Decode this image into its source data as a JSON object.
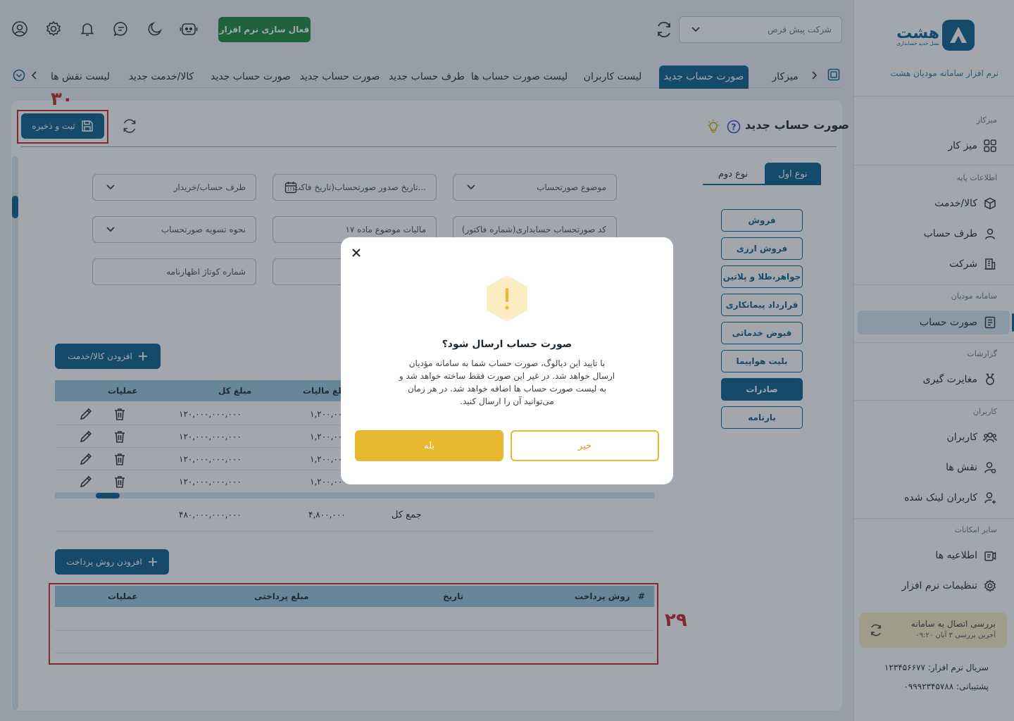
{
  "colors": {
    "primary": "#0f5f8e",
    "success": "#1f8a3d",
    "warning": "#e8b82e",
    "annotation": "#c62828"
  },
  "sidebar": {
    "logo_title": "هشت",
    "logo_tagline": "نسل جدید حسابداری",
    "subtitle": "نرم افزار سامانه مودیان هشت",
    "sections": [
      {
        "title": "میزکار",
        "items": [
          {
            "label": "میز کار",
            "icon": "grid-icon"
          }
        ]
      },
      {
        "title": "اطلاعات پایه",
        "items": [
          {
            "label": "کالا/خدمت",
            "icon": "box-icon"
          },
          {
            "label": "طرف حساب",
            "icon": "user-icon"
          },
          {
            "label": "شرکت",
            "icon": "building-icon"
          }
        ]
      },
      {
        "title": "سامانه مودیان",
        "items": [
          {
            "label": "صورت حساب",
            "icon": "invoice-icon"
          }
        ]
      },
      {
        "title": "گزارشات",
        "items": [
          {
            "label": "مغایرت گیری",
            "icon": "medal-icon"
          }
        ]
      },
      {
        "title": "کاربران",
        "items": [
          {
            "label": "کاربران",
            "icon": "users-icon"
          },
          {
            "label": "نقش ها",
            "icon": "user-role-icon"
          },
          {
            "label": "کاربران لینک شده",
            "icon": "user-link-icon"
          }
        ]
      },
      {
        "title": "سایر امکانات",
        "items": [
          {
            "label": "اطلاعیه ها",
            "icon": "announcement-icon"
          },
          {
            "label": "تنظیمات نرم افزار",
            "icon": "gear-icon"
          }
        ]
      }
    ],
    "connection": {
      "title": "بررسی اتصال به سامانه",
      "last_check": "آخرین بررسی  ۳ آبان  ۰۹:۲۰"
    },
    "serial": "سریال نرم افزار: ۱۲۳۴۵۶۶۷۷",
    "support": "پشتیبانی: ۰۹۹۹۲۳۴۵۷۸۸"
  },
  "header": {
    "company_select": "شرکت پیش فرض",
    "activate_label": "فعال سازی نرم افزار"
  },
  "tabs": [
    "میزکار",
    "صورت حساب جدید",
    "لیست کاربران",
    "لیست صورت حساب ها",
    "طرف حساب جدید",
    "صورت حساب جدید",
    "صورت حساب جدید",
    "کالا/خدمت جدید",
    "لیست نقش ها"
  ],
  "page": {
    "title": "صورت حساب جدید",
    "save_label": "ثبت و ذخیره",
    "type_tabs": [
      "نوع اول",
      "نوع دوم"
    ],
    "fields": {
      "subject": "موضوع صورتحساب",
      "issue_date": "تاریخ صدور صورتحساب(تاریخ فاکت...",
      "party": "طرف حساب/خریدار",
      "accounting_code": "کد صورتحساب حسابداری(شماره فاکتور)",
      "tax_article": "مالیات موضوع ماده ۱۷",
      "settlement": "نحوه تسویه صورتحساب",
      "customs": "شماره کوتاژ اظهارنامه"
    },
    "invoice_types": [
      "فروش",
      "فروش ارزی",
      "جواهر،طلا و پلاتین",
      "قرارداد پیمانکاری",
      "قبوض خدماتی",
      "بلیت هواپیما",
      "صادرات",
      "بارنامه"
    ],
    "active_invoice_type": "صادرات",
    "add_item_label": "افزودن کالا/خدمت",
    "items_table": {
      "headers": {
        "ops": "عملیات",
        "total": "مبلغ کل",
        "tax": "مبلغ مالیات"
      },
      "rows": [
        {
          "total": "۱۲۰,۰۰۰,۰۰۰,۰۰۰",
          "tax": "۱,۲۰۰,۰۰۰"
        },
        {
          "total": "۱۲۰,۰۰۰,۰۰۰,۰۰۰",
          "tax": "۱,۲۰۰,۰۰۰"
        },
        {
          "total": "۱۲۰,۰۰۰,۰۰۰,۰۰۰",
          "tax": "۱,۲۰۰,۰۰۰"
        },
        {
          "total": "۱۲۰,۰۰۰,۰۰۰,۰۰۰",
          "tax": "۱,۲۰۰,۰۰۰"
        }
      ],
      "sum_label": "جمع کل",
      "sum_total": "۴۸۰,۰۰۰,۰۰۰,۰۰۰",
      "sum_tax": "۴,۸۰۰,۰۰۰"
    },
    "add_payment_label": "افزودن روش پرداخت",
    "payment_table": {
      "hash": "#",
      "method": "روش پرداخت",
      "date": "تاریخ",
      "amount": "مبلغ پرداختی",
      "ops": "عملیات"
    }
  },
  "dialog": {
    "title": "صورت حساب ارسال شود؟",
    "body": "با تایید این دیالوگ، صورت حساب شما به سامانه مؤدیان ارسال خواهد شد. در غیر این صورت فقط ساخته خواهد شد و به لیست صورت حساب ها اضافه خواهد شد. در هر زمان می‌توانید آن را ارسال کنید.",
    "yes_label": "بله",
    "no_label": "خیر"
  },
  "annotations": {
    "save_number": "۳۰",
    "payment_number": "۲۹"
  }
}
